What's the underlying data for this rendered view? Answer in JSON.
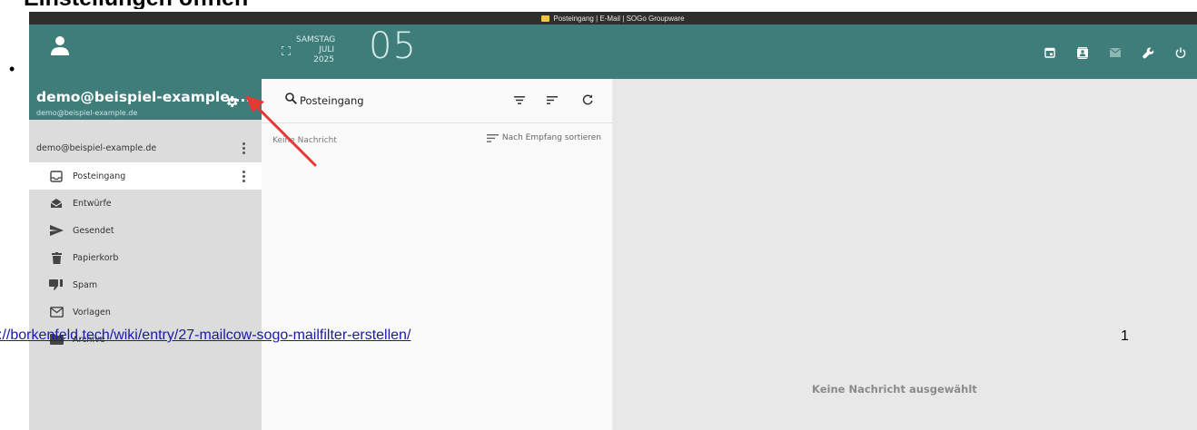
{
  "doc": {
    "heading": "Einstellungen öffnen",
    "bullet": "•",
    "link": "://borkenfeld.tech/wiki/entry/27-mailcow-sogo-mailfilter-erstellen/",
    "page_number": "1"
  },
  "window": {
    "title": "Posteingang | E-Mail | SOGo Groupware"
  },
  "account": {
    "name": "demo@beispiel-example....",
    "email": "demo@beispiel-example.de",
    "row_label": "demo@beispiel-example.de"
  },
  "date": {
    "weekday": "SAMSTAG",
    "month": "JULI",
    "year": "2025",
    "day": "05"
  },
  "folders": [
    {
      "label": "Posteingang",
      "icon": "inbox-icon",
      "active": true
    },
    {
      "label": "Entwürfe",
      "icon": "drafts-icon"
    },
    {
      "label": "Gesendet",
      "icon": "send-icon"
    },
    {
      "label": "Papierkorb",
      "icon": "trash-icon"
    },
    {
      "label": "Spam",
      "icon": "thumbs-down-icon"
    },
    {
      "label": "Vorlagen",
      "icon": "mail-icon"
    },
    {
      "label": "Archive",
      "icon": "folder-icon"
    }
  ],
  "list": {
    "title": "Posteingang",
    "empty": "Keine Nachricht",
    "sort_label": "Nach Empfang sortieren"
  },
  "reading": {
    "empty": "Keine Nachricht ausgewählt"
  },
  "top_icons": [
    "calendar-icon",
    "contacts-icon",
    "mail-icon",
    "wrench-icon",
    "power-icon"
  ],
  "colors": {
    "accent": "#3f7d7a",
    "annotation_arrow": "#e53935",
    "link": "#1a1aa6"
  }
}
